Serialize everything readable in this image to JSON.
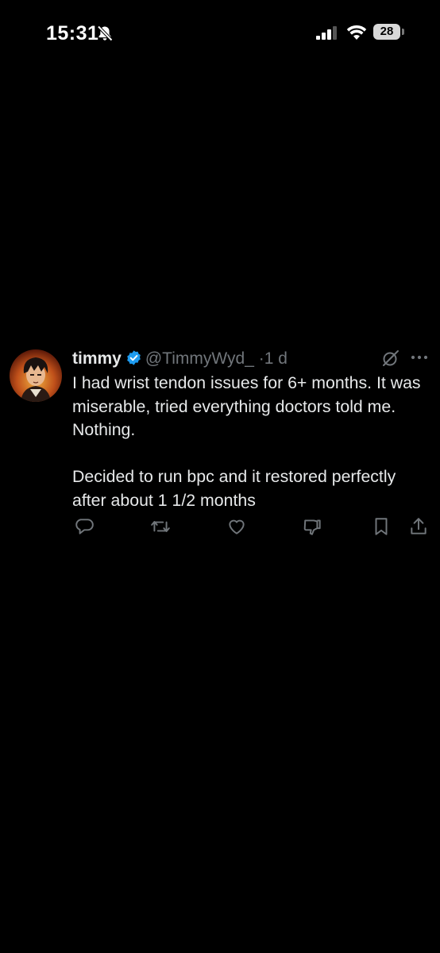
{
  "status_bar": {
    "time": "15:31",
    "battery_level": "28",
    "icons": [
      "bell-slash-icon",
      "signal-icon",
      "wifi-icon",
      "battery-icon"
    ]
  },
  "tweet": {
    "display_name": "timmy",
    "verified": true,
    "handle": "@TimmyWyd_",
    "separator": "·",
    "time": "1 d",
    "text_paragraphs": [
      "I had wrist tendon issues for 6+ months. It was miserable, tried everything doctors told me. Nothing.",
      "Decided to run bpc and it restored perfectly after about 1 1/2 months"
    ],
    "top_icons": [
      "grok-icon",
      "more-icon"
    ],
    "actions": [
      "reply-icon",
      "repost-icon",
      "like-icon",
      "dislike-icon",
      "bookmark-icon",
      "share-icon"
    ]
  },
  "colors": {
    "background": "#000000",
    "text": "#e7e9ea",
    "secondary": "#71767b",
    "verified": "#1d9bf0"
  }
}
